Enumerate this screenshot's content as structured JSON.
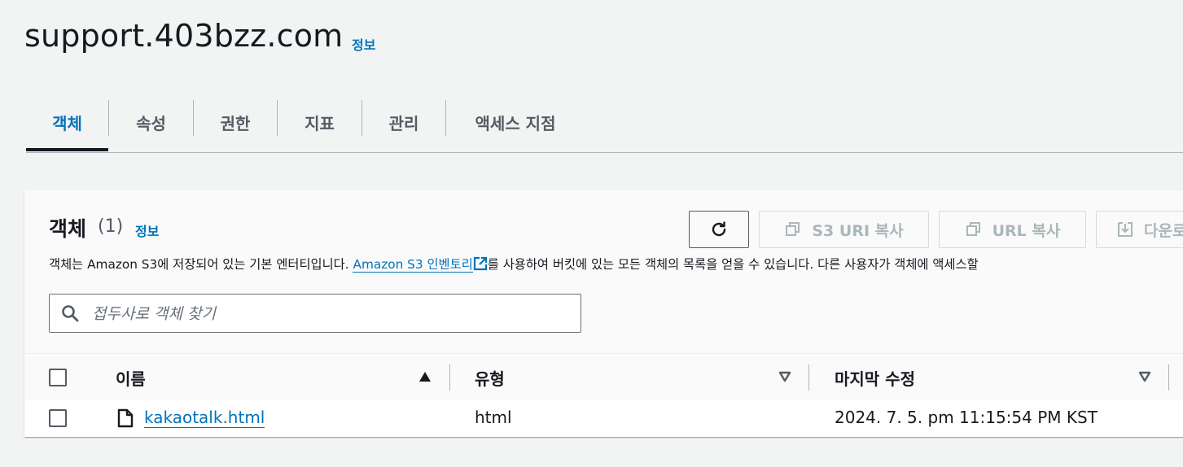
{
  "header": {
    "bucket_name": "support.403bzz.com",
    "info_label": "정보"
  },
  "tabs": [
    {
      "label": "객체",
      "active": true
    },
    {
      "label": "속성"
    },
    {
      "label": "권한"
    },
    {
      "label": "지표"
    },
    {
      "label": "관리"
    },
    {
      "label": "액세스 지점"
    }
  ],
  "objects_panel": {
    "title": "객체",
    "count": "(1)",
    "info_label": "정보",
    "description_before": "객체는 Amazon S3에 저장되어 있는 기본 엔터티입니다. ",
    "inventory_link": "Amazon S3 인벤토리",
    "description_after": "를 사용하여 버킷에 있는 모든 객체의 목록을 얻을 수 있습니다. 다른 사용자가 객체에 액세스할",
    "buttons": {
      "copy_s3_uri": "S3 URI 복사",
      "copy_url": "URL 복사",
      "download": "다운로드"
    },
    "search": {
      "placeholder": "접두사로 객체 찾기",
      "value": ""
    },
    "columns": [
      {
        "label": "이름",
        "sort": "ascending"
      },
      {
        "label": "유형",
        "sort": "none"
      },
      {
        "label": "마지막 수정",
        "sort": "none"
      }
    ],
    "rows": [
      {
        "name": "kakaotalk.html",
        "type": "html",
        "last_modified": "2024. 7. 5. pm 11:15:54 PM KST"
      }
    ]
  },
  "colors": {
    "link": "#0073bb",
    "text": "#16191f",
    "muted": "#545b64",
    "disabled": "#aab7b8",
    "background": "#f2f3f3"
  },
  "icons": [
    "refresh-icon",
    "copy-icon",
    "download-icon",
    "search-icon",
    "external-link-icon",
    "file-icon",
    "sort-ascending-icon",
    "sort-descending-icon"
  ]
}
